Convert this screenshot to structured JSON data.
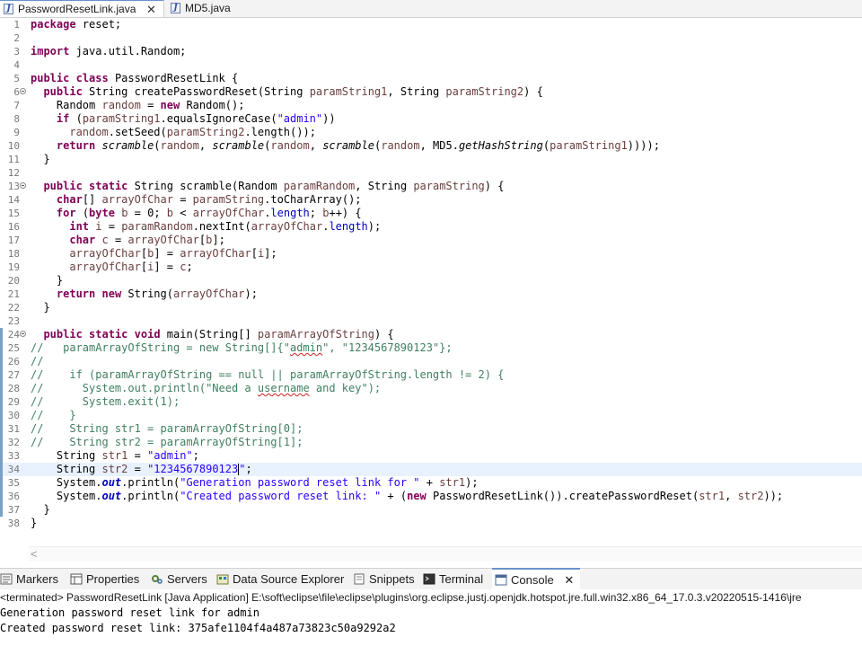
{
  "editor_tabs": [
    {
      "label": "PasswordResetLink.java",
      "icon": "java-file-icon",
      "active": true,
      "close": "✕"
    },
    {
      "label": "MD5.java",
      "icon": "java-file-icon",
      "active": false
    }
  ],
  "code_lines": [
    {
      "n": "1",
      "html": "<span class='kw'>package</span> reset;"
    },
    {
      "n": "2",
      "html": ""
    },
    {
      "n": "3",
      "html": "<span class='kw'>import</span> java.util.Random;"
    },
    {
      "n": "4",
      "html": ""
    },
    {
      "n": "5",
      "html": "<span class='kw'>public</span> <span class='kw'>class</span> PasswordResetLink {"
    },
    {
      "n": "6",
      "fold": true,
      "html": "  <span class='kw'>public</span> String createPasswordReset(String <span class='var'>paramString1</span>, String <span class='var'>paramString2</span>) {"
    },
    {
      "n": "7",
      "html": "    Random <span class='var'>random</span> = <span class='kw'>new</span> Random();"
    },
    {
      "n": "8",
      "html": "    <span class='kw'>if</span> (<span class='var'>paramString1</span>.equalsIgnoreCase(<span class='str'>\"admin\"</span>))"
    },
    {
      "n": "9",
      "html": "      <span class='var'>random</span>.setSeed(<span class='var'>paramString2</span>.length());"
    },
    {
      "n": "10",
      "html": "    <span class='kw'>return</span> <span class='it'>scramble</span>(<span class='var'>random</span>, <span class='it'>scramble</span>(<span class='var'>random</span>, <span class='it'>scramble</span>(<span class='var'>random</span>, MD5.<span class='it'>getHashString</span>(<span class='var'>paramString1</span>))));"
    },
    {
      "n": "11",
      "html": "  }"
    },
    {
      "n": "12",
      "html": ""
    },
    {
      "n": "13",
      "fold": true,
      "html": "  <span class='kw'>public</span> <span class='kw'>static</span> String scramble(Random <span class='var'>paramRandom</span>, String <span class='var'>paramString</span>) {"
    },
    {
      "n": "14",
      "html": "    <span class='kw'>char</span>[] <span class='var'>arrayOfChar</span> = <span class='var'>paramString</span>.toCharArray();"
    },
    {
      "n": "15",
      "html": "    <span class='kw'>for</span> (<span class='kw'>byte</span> <span class='var'>b</span> = 0; <span class='var'>b</span> &lt; <span class='var'>arrayOfChar</span>.<span class='fld'>length</span>; <span class='var'>b</span>++) {"
    },
    {
      "n": "16",
      "html": "      <span class='kw'>int</span> <span class='var'>i</span> = <span class='var'>paramRandom</span>.nextInt(<span class='var'>arrayOfChar</span>.<span class='fld'>length</span>);"
    },
    {
      "n": "17",
      "html": "      <span class='kw'>char</span> <span class='var'>c</span> = <span class='var'>arrayOfChar</span>[<span class='var'>b</span>];"
    },
    {
      "n": "18",
      "html": "      <span class='var'>arrayOfChar</span>[<span class='var'>b</span>] = <span class='var'>arrayOfChar</span>[<span class='var'>i</span>];"
    },
    {
      "n": "19",
      "html": "      <span class='var'>arrayOfChar</span>[<span class='var'>i</span>] = <span class='var'>c</span>;"
    },
    {
      "n": "20",
      "html": "    }"
    },
    {
      "n": "21",
      "html": "    <span class='kw'>return</span> <span class='kw'>new</span> String(<span class='var'>arrayOfChar</span>);"
    },
    {
      "n": "22",
      "html": "  }"
    },
    {
      "n": "23",
      "html": ""
    },
    {
      "n": "24",
      "fold": true,
      "bar": true,
      "html": "  <span class='kw'>public</span> <span class='kw'>static</span> <span class='kw'>void</span> main(String[] <span class='var'>paramArrayOfString</span>) {"
    },
    {
      "n": "25",
      "bar": true,
      "html": "<span class='cm'>//   paramArrayOfString = new String[]{\"<span class='sq'>admin</span>\", \"1234567890123\"};</span>"
    },
    {
      "n": "26",
      "bar": true,
      "html": "<span class='cm'>//</span>"
    },
    {
      "n": "27",
      "bar": true,
      "html": "<span class='cm'>//    if (paramArrayOfString == null || paramArrayOfString.length != 2) {</span>"
    },
    {
      "n": "28",
      "bar": true,
      "html": "<span class='cm'>//      System.out.println(\"Need a <span class='sq'>username</span> and key\");</span>"
    },
    {
      "n": "29",
      "bar": true,
      "html": "<span class='cm'>//      System.exit(1);</span>"
    },
    {
      "n": "30",
      "bar": true,
      "html": "<span class='cm'>//    }</span>"
    },
    {
      "n": "31",
      "bar": true,
      "html": "<span class='cm'>//    String str1 = paramArrayOfString[0];</span>"
    },
    {
      "n": "32",
      "bar": true,
      "html": "<span class='cm'>//    String str2 = paramArrayOfString[1];</span>"
    },
    {
      "n": "33",
      "bar": true,
      "html": "    String <span class='var'>str1</span> = <span class='str'>\"admin\"</span>;"
    },
    {
      "n": "34",
      "bar": true,
      "cur": true,
      "html": "    String <span class='var'>str2</span> = <span class='str'>\"1234567890123</span><span class='caret'></span><span class='str'>\"</span>;"
    },
    {
      "n": "35",
      "bar": true,
      "html": "    System.<span class='sfld'>out</span>.println(<span class='str'>\"Generation password reset link for \"</span> + <span class='var'>str1</span>);"
    },
    {
      "n": "36",
      "bar": true,
      "html": "    System.<span class='sfld'>out</span>.println(<span class='str'>\"Created password reset link: \"</span> + (<span class='kw'>new</span> PasswordResetLink()).createPasswordReset(<span class='var'>str1</span>, <span class='var'>str2</span>));"
    },
    {
      "n": "37",
      "bar": true,
      "html": "  }"
    },
    {
      "n": "38",
      "html": "}"
    }
  ],
  "hscroll": {
    "left_arrow": "<"
  },
  "panel_tabs": [
    {
      "label": "Markers",
      "icon": "markers-icon",
      "active": false
    },
    {
      "label": "Properties",
      "icon": "properties-icon",
      "active": false
    },
    {
      "label": "Servers",
      "icon": "servers-icon",
      "active": false
    },
    {
      "label": "Data Source Explorer",
      "icon": "data-source-explorer-icon",
      "active": false
    },
    {
      "label": "Snippets",
      "icon": "snippets-icon",
      "active": false
    },
    {
      "label": "Terminal",
      "icon": "terminal-icon",
      "active": false
    },
    {
      "label": "Console",
      "icon": "console-icon",
      "active": true,
      "close": "✕"
    }
  ],
  "console": {
    "header": "<terminated> PasswordResetLink [Java Application] E:\\soft\\eclipse\\file\\eclipse\\plugins\\org.eclipse.justj.openjdk.hotspot.jre.full.win32.x86_64_17.0.3.v20220515-1416\\jre",
    "lines": [
      "Generation password reset link for admin",
      "Created password reset link: 375afe1104f4a487a73823c50a9292a2"
    ]
  },
  "colors": {
    "keyword": "#7f0055",
    "string": "#2a00ff",
    "comment": "#3f7f5f",
    "variable": "#6a3e3e",
    "current_line": "#e8f2fe"
  }
}
